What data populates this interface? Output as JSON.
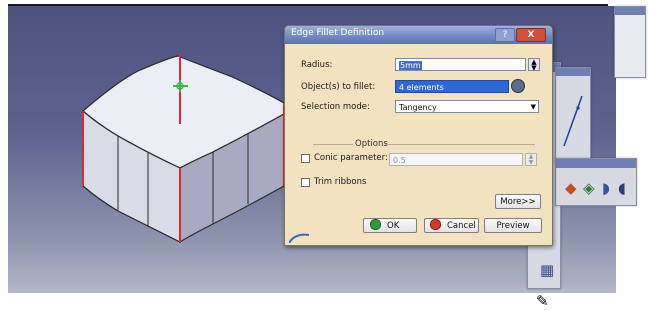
{
  "dialog": {
    "title": "Edge Fillet Definition",
    "help_label": "?",
    "close_label": "X",
    "radius": {
      "label": "Radius:",
      "value": "5mm"
    },
    "objects": {
      "label": "Object(s) to fillet:",
      "value": "4 elements"
    },
    "selection_mode": {
      "label": "Selection mode:",
      "value": "Tangency"
    },
    "options": {
      "heading": "Options",
      "conic_parameter": {
        "label": "Conic parameter:",
        "value": "0.5",
        "checked": false
      },
      "trim_ribbons": {
        "label": "Trim ribbons",
        "checked": false
      }
    },
    "buttons": {
      "more": "More>>",
      "ok": "OK",
      "cancel": "Cancel",
      "preview": "Preview"
    }
  },
  "icons": [
    "spin-up-down-icon",
    "selection-list-icon",
    "dropdown-arrow-icon",
    "ok-icon",
    "cancel-icon",
    "fillet-toolbar-icons"
  ],
  "colors": {
    "dialog_background": "#f2e2bf",
    "titlebar": "#6e86c3",
    "viewport_top": "#4e527f",
    "viewport_bottom": "#b4b7c8",
    "selected_edge": "#e0263a",
    "part_face": "#e6e7ef"
  }
}
